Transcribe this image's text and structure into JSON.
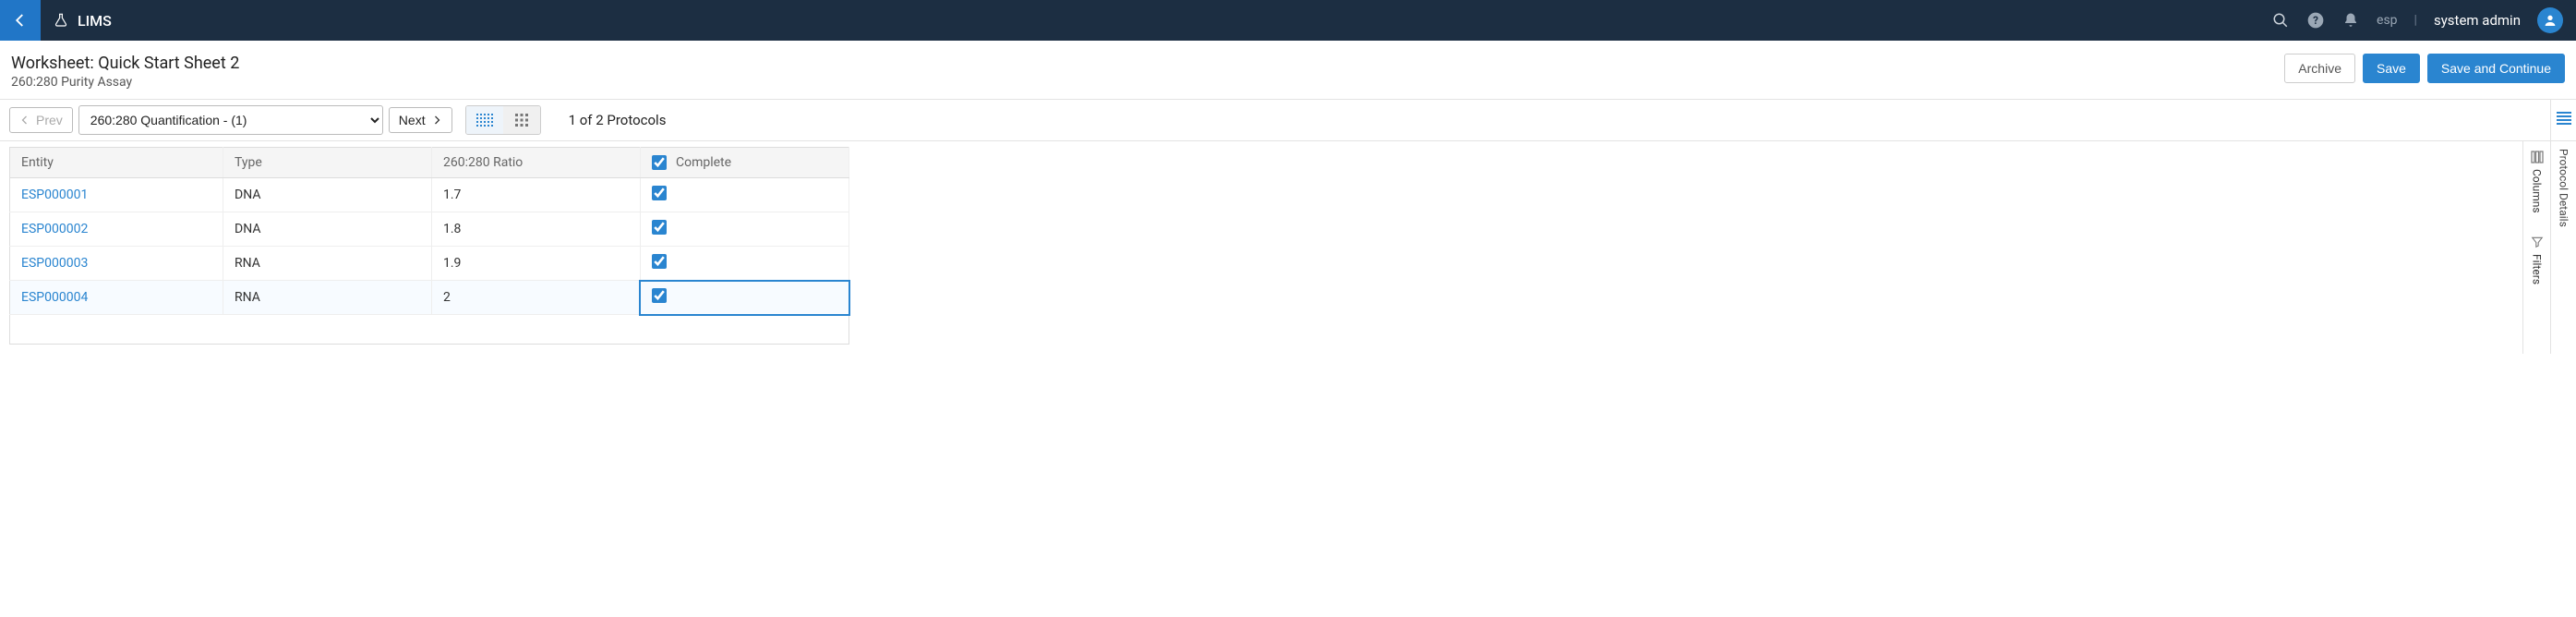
{
  "topbar": {
    "brand": "LIMS",
    "user_scope": "esp",
    "user_name": "system admin"
  },
  "header": {
    "title": "Worksheet: Quick Start Sheet 2",
    "subtitle": "260:280 Purity Assay",
    "archive_label": "Archive",
    "save_label": "Save",
    "save_continue_label": "Save and Continue"
  },
  "toolbar": {
    "prev_label": "Prev",
    "next_label": "Next",
    "protocol_select_value": "260:280 Quantification - (1)",
    "protocol_count": "1 of 2 Protocols"
  },
  "table": {
    "columns": {
      "entity": "Entity",
      "type": "Type",
      "ratio": "260:280 Ratio",
      "complete": "Complete"
    },
    "header_complete_checked": true,
    "rows": [
      {
        "entity": "ESP000001",
        "type": "DNA",
        "ratio": "1.7",
        "complete": true,
        "selected": false
      },
      {
        "entity": "ESP000002",
        "type": "DNA",
        "ratio": "1.8",
        "complete": true,
        "selected": false
      },
      {
        "entity": "ESP000003",
        "type": "RNA",
        "ratio": "1.9",
        "complete": true,
        "selected": false
      },
      {
        "entity": "ESP000004",
        "type": "RNA",
        "ratio": "2",
        "complete": true,
        "selected": true
      }
    ]
  },
  "sidepanel": {
    "columns_label": "Columns",
    "filters_label": "Filters",
    "protocol_details_label": "Protocol Details"
  }
}
